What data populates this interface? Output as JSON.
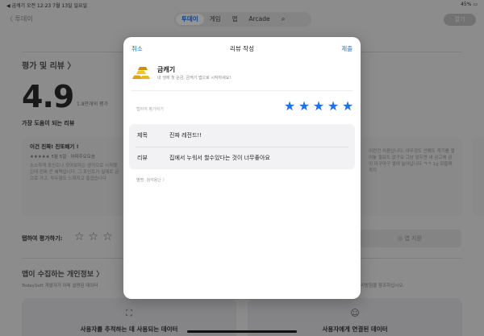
{
  "status_bar": {
    "left": "◀ 금캐기   오전 12:23   7월 13일 일요일",
    "right": "45% ▭"
  },
  "nav": {
    "back_label": "〈 투데이",
    "tabs": [
      {
        "label": "투데이",
        "active": true
      },
      {
        "label": "게임",
        "active": false
      },
      {
        "label": "앱",
        "active": false
      },
      {
        "label": "Arcade",
        "active": false
      }
    ],
    "open_label": "열기"
  },
  "background": {
    "ratings_title": "평가 및 리뷰 〉",
    "big_rating": "4.9",
    "rating_count": "1.8만개의 평가",
    "helpful_title": "가장 도움이 되는 리뷰",
    "cards": [
      {
        "title": "이건 진짜! 진또배기 !",
        "sub": "★★★★★  5월 5일 · 아파주오오솜",
        "body": "소소하게 포인트나 모아보자는 생각으로 시작했는데 진짜 큰 혜택입니다. 그 포인트가 실제로 금으로 가고, 투두함도 느껴지고 흥겹습니다"
      },
      {
        "title": "",
        "sub": "",
        "body": "이런건 처음입니다. 아무것도 안해도 캐기를 열어놓 필요도 없구요 그냥 앞두면 내 금고에 금이 마구마구 쌓여 늘어납니다 ㅋㅋ 1g 모을때까지"
      }
    ],
    "tap_rate": "탭하여 평가하기:",
    "support_label": "◎ 앱 지원",
    "privacy_title": "앱이 수집하는 개인정보 〉",
    "privacy_sub": "TodaySoft 개발자가 아래 설명된 데이터",
    "privacy_note": "개인정보 처리방침을 참조하십시오.",
    "privacy_cards": [
      {
        "label": "사용자를 추적하는 데 사용되는 데이터"
      },
      {
        "label": "사용자에게 연결된 데이터"
      }
    ]
  },
  "sheet": {
    "cancel_label": "취소",
    "title": "리뷰 작성",
    "submit_label": "제출",
    "app_name": "금캐기",
    "app_desc": "내 생애 첫 순금, 금캐기 앱으로 시작하세요!",
    "rate_label": "탭하여 평가하기",
    "rating": 5,
    "rating_max": 5,
    "form": {
      "title_key": "제목",
      "title_value": "진짜 레전드!!",
      "review_key": "리뷰",
      "review_value": "집에서 누워서 할수있다는 것이 너무좋아요"
    },
    "nickname": "별명: 검각용난 〉"
  },
  "colors": {
    "accent": "#1a73e8",
    "sheet_bg": "#ffffff",
    "form_bg": "#f2f2f4"
  }
}
